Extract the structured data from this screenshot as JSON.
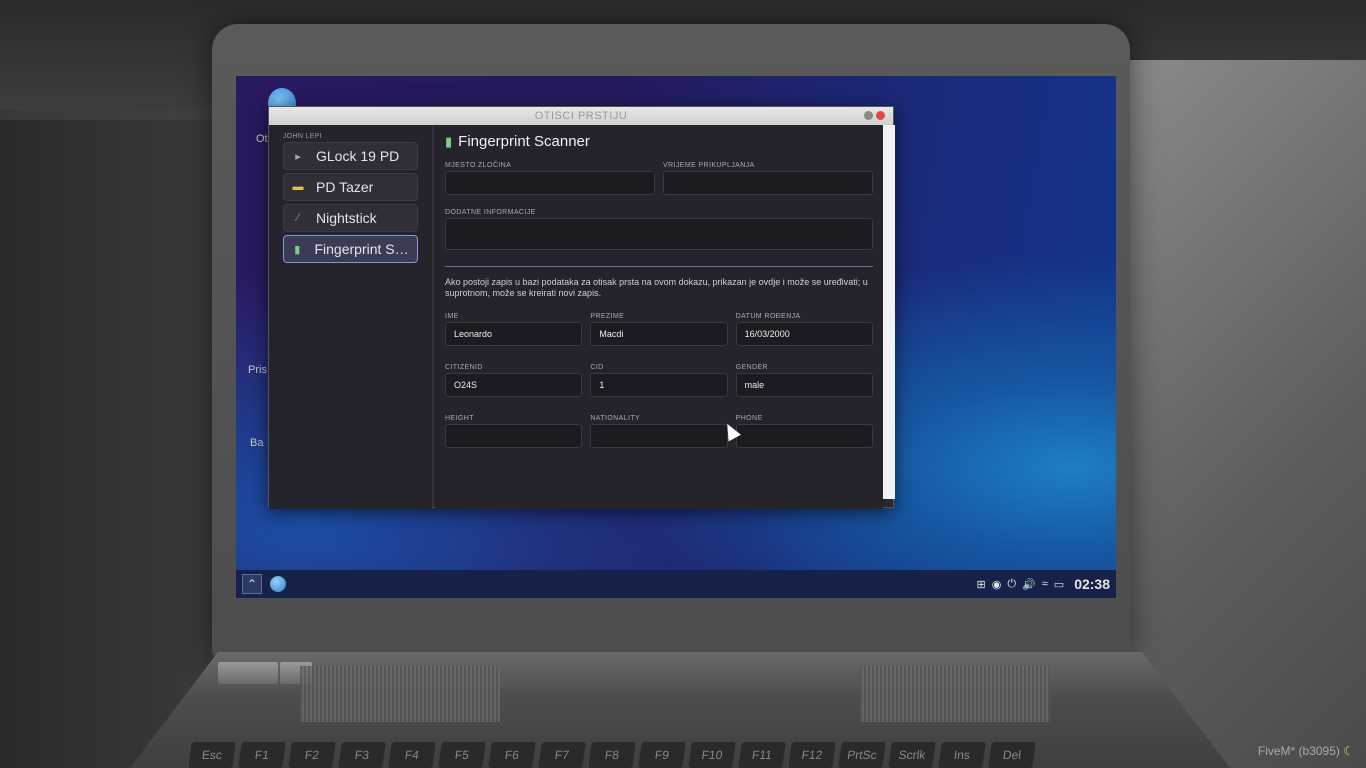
{
  "window": {
    "title": "OTISCI PRSTIJU",
    "accent_color": "#8d93d8"
  },
  "sidebar": {
    "label": "JOHN LEPI",
    "items": [
      {
        "label": "GLock 19 PD",
        "icon": "pistol-icon"
      },
      {
        "label": "PD Tazer",
        "icon": "taser-icon"
      },
      {
        "label": "Nightstick",
        "icon": "baton-icon"
      },
      {
        "label": "Fingerprint Sca...",
        "icon": "fingerprint-scanner-icon",
        "active": true
      }
    ]
  },
  "main": {
    "title": "Fingerprint Scanner",
    "top_fields": {
      "place_label": "MJESTO ZLOČINA",
      "place_value": "",
      "time_label": "VRIJEME PRIKUPLJANJA",
      "time_value": "",
      "info_label": "DODATNE INFORMACIJE",
      "info_value": ""
    },
    "notice": "Ako postoji zapis u bazi podataka za otisak prsta na ovom dokazu, prikazan je ovdje i može se uređivati; u suprotnom, može se kreirati novi zapis.",
    "person": {
      "first_name_label": "IME",
      "first_name": "Leonardo",
      "last_name_label": "PREZIME",
      "last_name": "Macdi",
      "dob_label": "DATUM ROĐENJA",
      "dob": "16/03/2000",
      "citizenid_label": "CITIZENID",
      "citizenid": "O24S",
      "cid_label": "CID",
      "cid": "1",
      "gender_label": "GENDER",
      "gender": "male",
      "height_label": "HEIGHT",
      "nationality_label": "NATIONALITY",
      "phone_label": "PHONE"
    }
  },
  "desktop": {
    "labels": [
      "Ot",
      "Pris",
      "Ba"
    ]
  },
  "taskbar": {
    "clock": "02:38",
    "start_icon": "chevron-up-icon"
  },
  "keyboard": {
    "keys": [
      "Esc",
      "F1",
      "F2",
      "F3",
      "F4",
      "F5",
      "F6",
      "F7",
      "F8",
      "F9",
      "F10",
      "F11",
      "F12",
      "PrtSc",
      "Scrlk",
      "Ins",
      "Del"
    ]
  },
  "watermark": "FiveM* (b3095)"
}
